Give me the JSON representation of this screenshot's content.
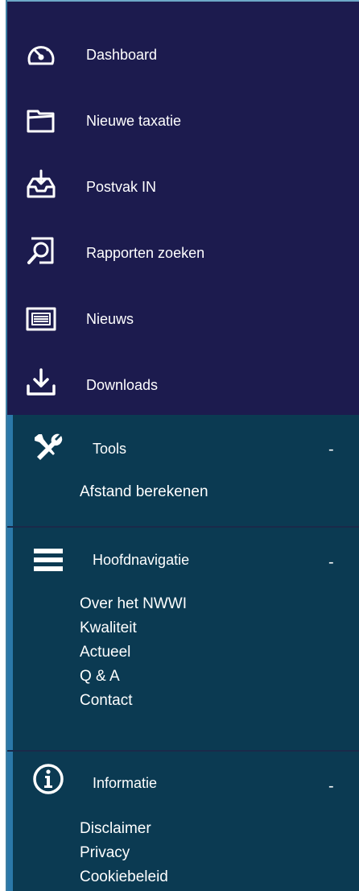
{
  "nav": {
    "items": [
      {
        "label": "Dashboard",
        "icon": "dashboard-gauge-icon"
      },
      {
        "label": "Nieuwe taxatie",
        "icon": "folder-icon"
      },
      {
        "label": "Postvak IN",
        "icon": "inbox-icon"
      },
      {
        "label": "Rapporten zoeken",
        "icon": "search-document-icon"
      },
      {
        "label": "Nieuws",
        "icon": "newspaper-icon"
      },
      {
        "label": "Downloads",
        "icon": "download-icon"
      }
    ]
  },
  "sections": {
    "tools": {
      "title": "Tools",
      "toggle": "-",
      "icon": "tools-icon",
      "links": [
        "Afstand berekenen"
      ]
    },
    "hoofdnavigatie": {
      "title": "Hoofdnavigatie",
      "toggle": "-",
      "icon": "menu-icon",
      "links": [
        "Over het NWWI",
        "Kwaliteit",
        "Actueel",
        "Q & A",
        "Contact"
      ]
    },
    "informatie": {
      "title": "Informatie",
      "toggle": "-",
      "icon": "info-icon",
      "links": [
        "Disclaimer",
        "Privacy",
        "Cookiebeleid"
      ]
    }
  },
  "colors": {
    "nav_background": "#1c1b4e",
    "section_background": "#0b3a52",
    "accent": "#2b78a9",
    "text": "#ffffff"
  }
}
